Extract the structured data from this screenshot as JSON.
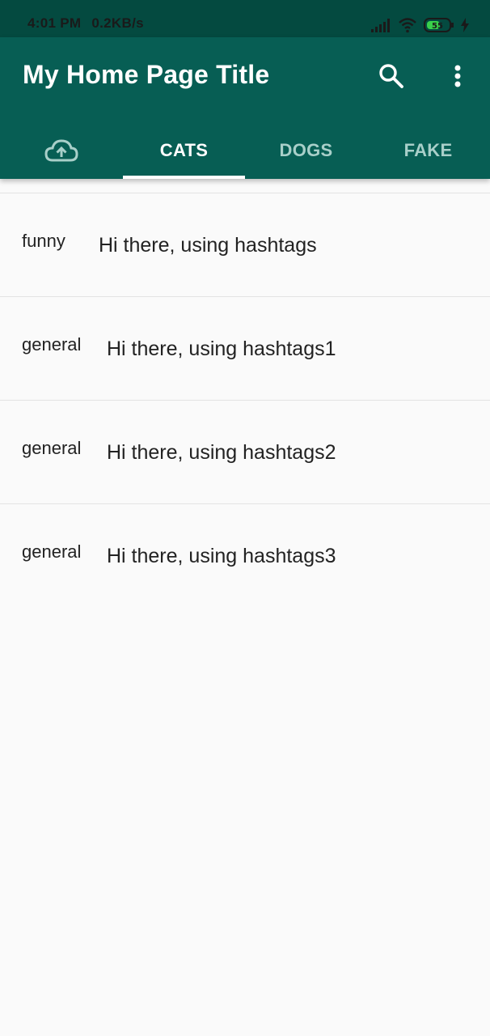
{
  "status_bar": {
    "time": "4:01 PM",
    "speed": "0.2KB/s",
    "battery": "55"
  },
  "app_bar": {
    "title": "My Home Page Title",
    "actions": {
      "search_icon": "search-icon",
      "more_icon": "more-vert-icon"
    }
  },
  "tabs": {
    "camera_icon": "cloud-upload-icon",
    "items": [
      {
        "label": "CATS",
        "selected": true
      },
      {
        "label": "DOGS",
        "selected": false
      },
      {
        "label": "FAKE",
        "selected": false
      }
    ]
  },
  "list": {
    "items": [
      {
        "tag": "funny",
        "text": "Hi there, using hashtags"
      },
      {
        "tag": "general",
        "text": "Hi there, using hashtags1"
      },
      {
        "tag": "general",
        "text": "Hi there, using hashtags2"
      },
      {
        "tag": "general",
        "text": "Hi there, using hashtags3"
      }
    ]
  },
  "colors": {
    "primary": "#075e54",
    "status_bar": "#044a40",
    "selected_tab": "#ffffff",
    "unselected_tab": "#a8cfc9",
    "background": "#fafafa"
  }
}
